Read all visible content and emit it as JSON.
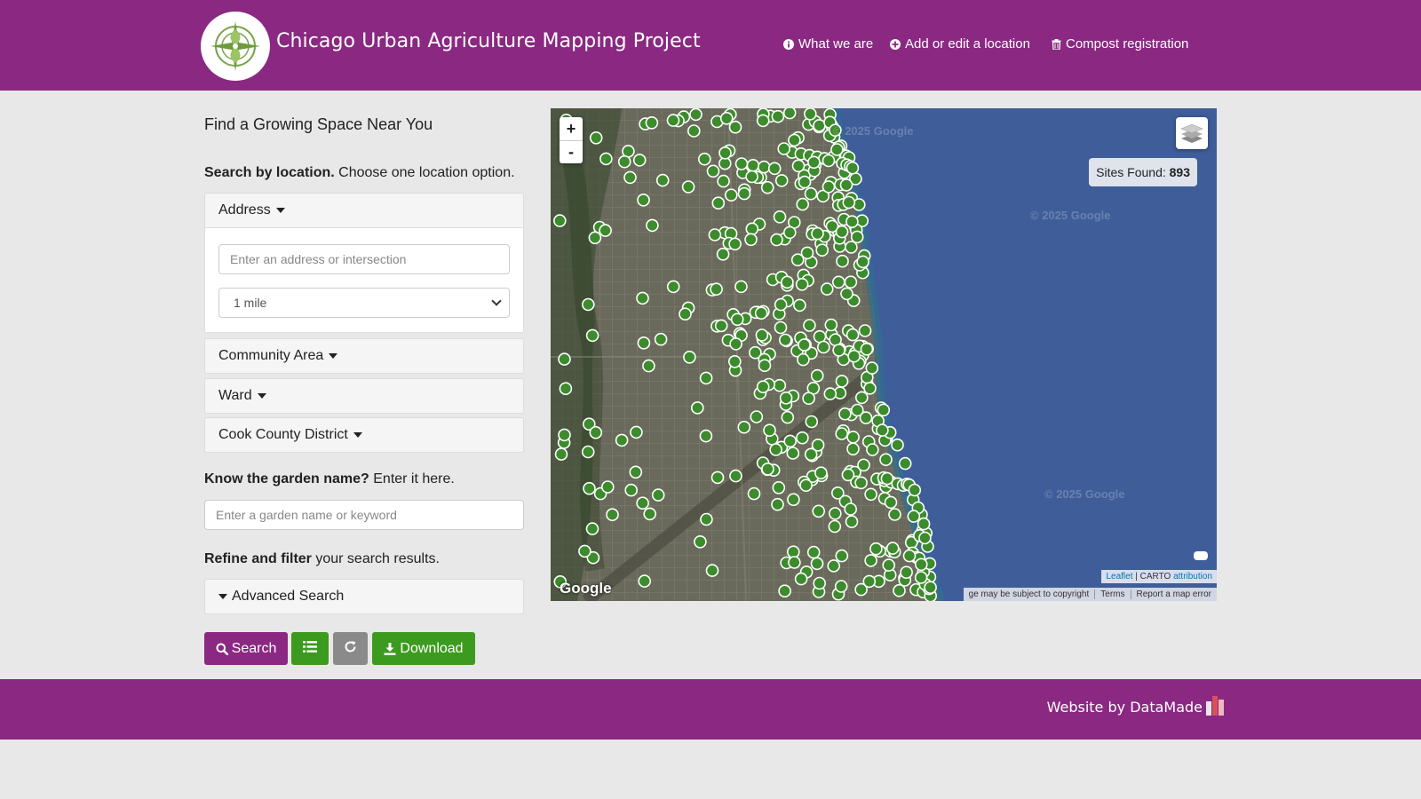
{
  "header": {
    "title": "Chicago Urban Agriculture Mapping Project",
    "nav": [
      {
        "label": "What we are",
        "icon": "info-icon"
      },
      {
        "label": "Add or edit a location",
        "icon": "plus-circle-icon"
      },
      {
        "label": "Compost registration",
        "icon": "trash-icon"
      }
    ]
  },
  "search": {
    "panel_title": "Find a Growing Space Near You",
    "location_bold": "Search by location.",
    "location_rest": " Choose one location option.",
    "address_label": "Address",
    "address_placeholder": "Enter an address or intersection",
    "radius_selected": "1 mile",
    "community_label": "Community Area",
    "ward_label": "Ward",
    "district_label": "Cook County District",
    "name_bold": "Know the garden name?",
    "name_rest": " Enter it here.",
    "name_placeholder": "Enter a garden name or keyword",
    "refine_bold": "Refine and filter",
    "refine_rest": " your search results.",
    "advanced_label": "Advanced Search"
  },
  "buttons": {
    "search_label": "Search",
    "download_label": "Download"
  },
  "map": {
    "sites_found_label": "Sites Found:",
    "sites_found_count": "893",
    "zoom_in": "+",
    "zoom_out": "-",
    "watermark": "© 2025 Google",
    "google_logo": "Google",
    "attrib_leaflet": "Leaflet",
    "attrib_sep": " | CARTO ",
    "attrib_link": "attribution",
    "imagery_note": "ge may be subject to copyright",
    "terms": "Terms",
    "report": "Report a map error"
  },
  "footer": {
    "credit": "Website by DataMade"
  },
  "colors": {
    "brand_purple": "#8a2882",
    "marker_green": "#3c8b2c",
    "download_green": "#3c9a1e",
    "reset_gray": "#8a8a8a",
    "water": "#3f5d99"
  }
}
